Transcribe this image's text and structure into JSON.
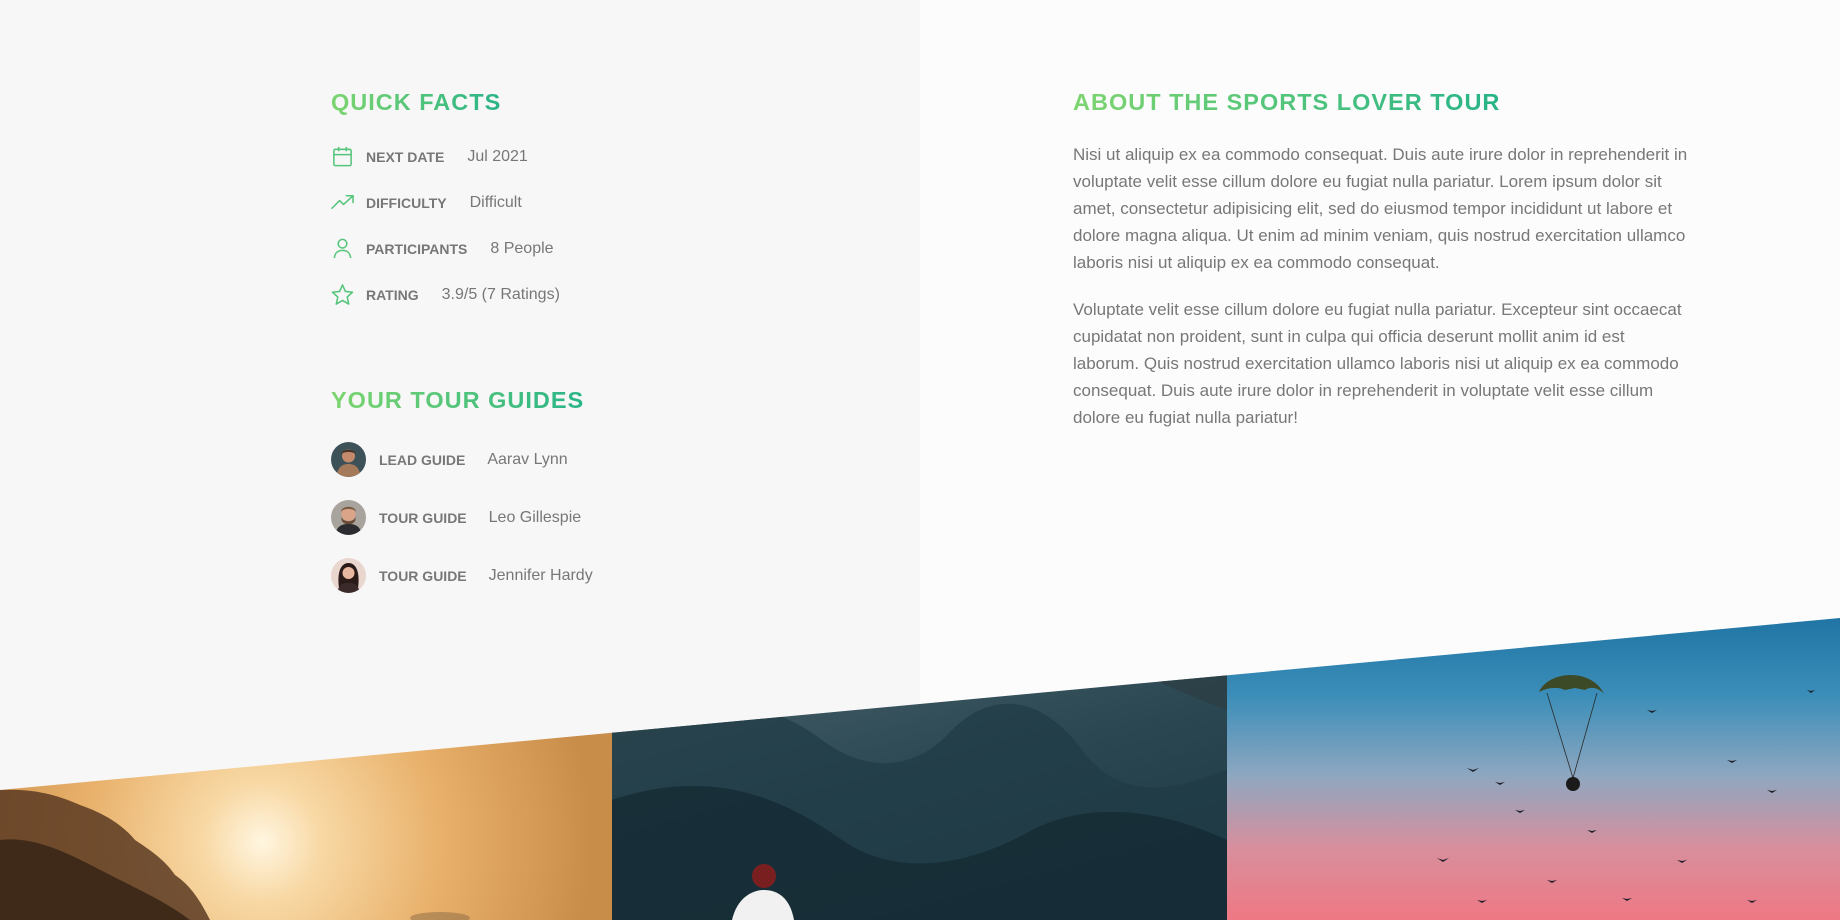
{
  "quick_facts": {
    "heading": "Quick Facts",
    "items": [
      {
        "icon": "calendar-icon",
        "label": "Next Date",
        "value": "Jul 2021"
      },
      {
        "icon": "trending-up-icon",
        "label": "Difficulty",
        "value": "Difficult"
      },
      {
        "icon": "user-icon",
        "label": "Participants",
        "value": "8 People"
      },
      {
        "icon": "star-icon",
        "label": "Rating",
        "value": "3.9/5 (7 Ratings)"
      }
    ]
  },
  "tour_guides": {
    "heading": "Your Tour Guides",
    "items": [
      {
        "role": "Lead Guide",
        "name": "Aarav Lynn"
      },
      {
        "role": "Tour Guide",
        "name": "Leo Gillespie"
      },
      {
        "role": "Tour Guide",
        "name": "Jennifer Hardy"
      }
    ]
  },
  "about": {
    "heading": "About the Sports Lover Tour",
    "paragraphs": [
      "Nisi ut aliquip ex ea commodo consequat. Duis aute irure dolor in reprehenderit in voluptate velit esse cillum dolore eu fugiat nulla pariatur. Lorem ipsum dolor sit amet, consectetur adipisicing elit, sed do eiusmod tempor incididunt ut labore et dolore magna aliqua. Ut enim ad minim veniam, quis nostrud exercitation ullamco laboris nisi ut aliquip ex ea commodo consequat.",
      "Voluptate velit esse cillum dolore eu fugiat nulla pariatur. Excepteur sint occaecat cupidatat non proident, sunt in culpa qui officia deserunt mollit anim id est laborum. Quis nostrud exercitation ullamco laboris nisi ut aliquip ex ea commodo consequat. Duis aute irure dolor in reprehenderit in voluptate velit esse cillum dolore eu fugiat nulla pariatur!"
    ]
  },
  "colors": {
    "accent_start": "#7dd56f",
    "accent_end": "#28b487",
    "text": "#777777"
  }
}
